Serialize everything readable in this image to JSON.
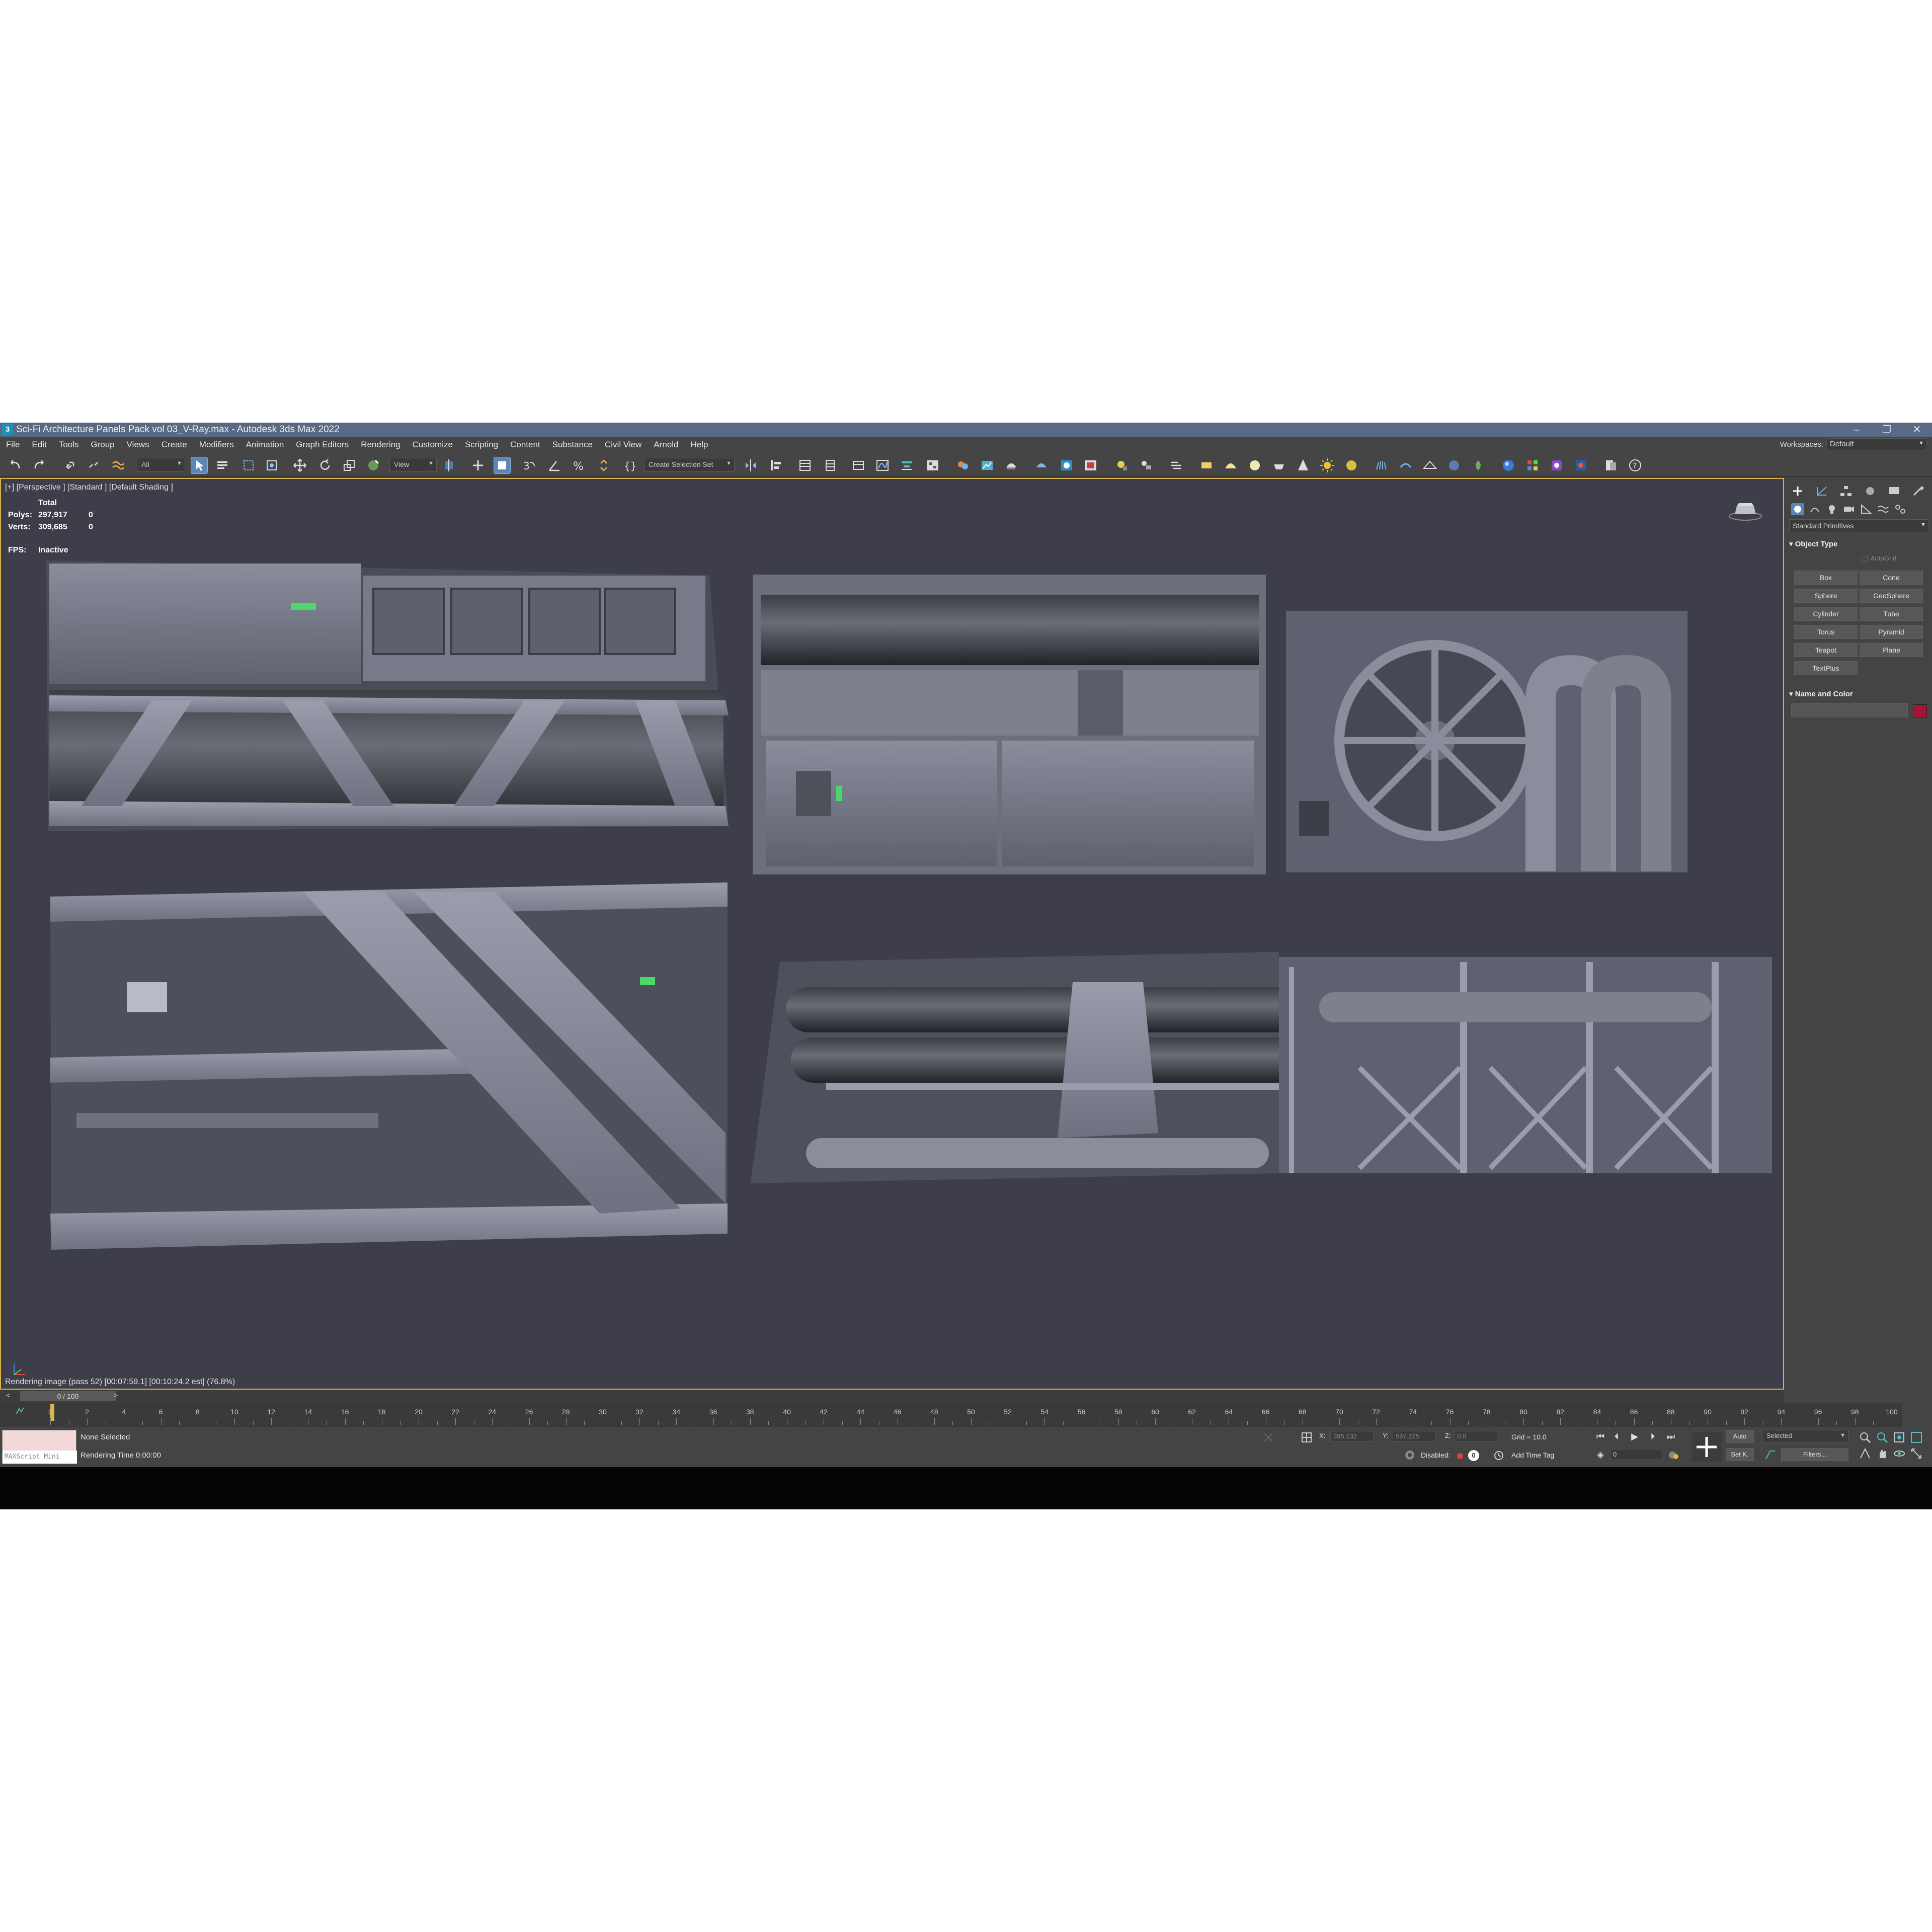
{
  "window": {
    "title": "Sci-Fi Architecture Panels Pack vol 03_V-Ray.max - Autodesk 3ds Max 2022",
    "app_icon": "3",
    "controls": [
      "–",
      "❐",
      "✕"
    ]
  },
  "menu": [
    "File",
    "Edit",
    "Tools",
    "Group",
    "Views",
    "Create",
    "Modifiers",
    "Animation",
    "Graph Editors",
    "Rendering",
    "Customize",
    "Scripting",
    "Content",
    "Substance",
    "Civil View",
    "Arnold",
    "Help"
  ],
  "workspaces": {
    "label": "Workspaces:",
    "value": "Default"
  },
  "toolbar": {
    "filter": "All",
    "ref_coord": "View",
    "selection_set": "Create Selection Set"
  },
  "viewport": {
    "label": "[+] [Perspective ] [Standard ] [Default Shading ]",
    "stats": {
      "header": "Total",
      "polys_label": "Polys:",
      "polys": "297,917",
      "polys_sel": "0",
      "verts_label": "Verts:",
      "verts": "309,685",
      "verts_sel": "0",
      "fps_label": "FPS:",
      "fps": "Inactive"
    },
    "render_status": "Rendering image (pass 52) [00:07:59.1] [00:10:24.2 est]     (76.8%)"
  },
  "command_panel": {
    "category": "Standard Primitives",
    "object_type_title": "Object Type",
    "autogrid": "AutoGrid",
    "primitives": [
      "Box",
      "Cone",
      "Sphere",
      "GeoSphere",
      "Cylinder",
      "Tube",
      "Torus",
      "Pyramid",
      "Teapot",
      "Plane",
      "TextPlus"
    ],
    "name_color_title": "Name and Color",
    "object_color": "#a3163a"
  },
  "time": {
    "slider": "0 / 100",
    "prev": "<",
    "next": ">",
    "labels": [
      "0",
      "2",
      "4",
      "6",
      "8",
      "10",
      "12",
      "14",
      "16",
      "18",
      "20",
      "22",
      "24",
      "26",
      "28",
      "30",
      "32",
      "34",
      "36",
      "38",
      "40",
      "42",
      "44",
      "46",
      "48",
      "50",
      "52",
      "54",
      "56",
      "58",
      "60",
      "62",
      "64",
      "66",
      "68",
      "70",
      "72",
      "74",
      "76",
      "78",
      "80",
      "82",
      "84",
      "86",
      "88",
      "90",
      "92",
      "94",
      "96",
      "98",
      "100"
    ]
  },
  "status": {
    "maxscript": "MAXScript Mini",
    "selection": "None Selected",
    "render_time": "Rendering Time  0:00:00",
    "x_label": "X:",
    "x_val": "395.132",
    "y_label": "Y:",
    "y_val": "597.275",
    "z_label": "Z:",
    "z_val": "0.0",
    "grid": "Grid = 10.0",
    "disabled": "Disabled:",
    "disabled_val": "0",
    "add_time_tag": "Add Time Tag",
    "auto": "Auto",
    "selected": "Selected",
    "setk": "Set K.",
    "filters": "Filters...",
    "frame": "0"
  },
  "colors": {
    "accent": "#5a86b8",
    "viewport_bg": "#3d3e49",
    "viewport_border": "#d9b44a",
    "panel_bg": "#444444"
  }
}
